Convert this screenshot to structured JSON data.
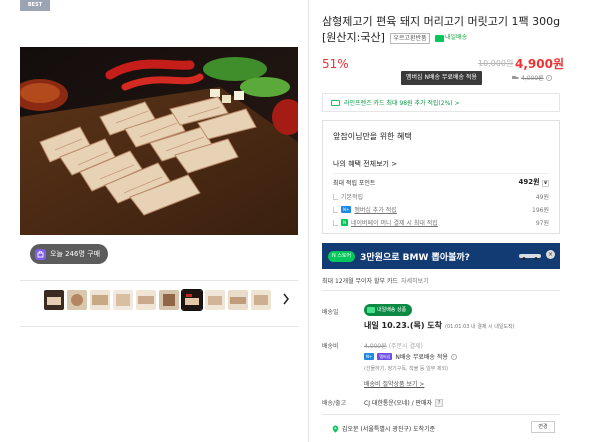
{
  "badge": "BEST",
  "product": {
    "title": "삼형제고기 편육 돼지 머리고기 머릿고기 1팩 300g [원산지:국산]",
    "tag_guarantee": "우르고환반품",
    "tag_delivery": "내일배송"
  },
  "price": {
    "discount": "51%",
    "original": "10,000원",
    "sale": "4,900원",
    "member_tip": "멤버십 N배송 무료배송 적용",
    "member_original": "4,000원"
  },
  "card_banner": "라인프렌즈 카드 최대 98원 추가 적립(2%) >",
  "benefits": {
    "title": "앞잡이님만을 위한 혜택",
    "view_all": "나의 혜택 전체보기 >",
    "max_label": "최대 적립 포인트",
    "max_value": "492원",
    "items": [
      {
        "label": "기본적립",
        "value": "49원"
      },
      {
        "label": "멤버십 추가 적립",
        "value": "196원",
        "badge": "N+"
      },
      {
        "label": "네이버페이 머니 결제 시 최대 적립",
        "value": "97원",
        "badge": "N"
      }
    ]
  },
  "ad": {
    "pill": "N 스토어",
    "text": "3만원으로 BMW 뽑아볼까?",
    "close": "×"
  },
  "installment": {
    "text": "최대 12개월 무이자 할부 카드",
    "more": "자세히보기"
  },
  "gallery": {
    "sold_text": "오늘 246명 구매",
    "thumb_count_selected": 8
  },
  "delivery": {
    "label": "배송일",
    "badge": "내일배송 상품",
    "date": "내일 10.23.(목) 도착",
    "note": "(01:01:03 내 결제 시 내일도착)"
  },
  "shipping_fee": {
    "label": "배송비",
    "amount": "4,000원",
    "condition": "(주문시 결제)",
    "free_text": "N배송 무료배송 적용",
    "free_badge_n": "N+",
    "free_badge_member": "멤버십",
    "sub": "(선물하기, 정기구독, 착불 등 일부 제외)",
    "link": "배송비 절약상품 보기"
  },
  "carrier": {
    "label": "배송/출고",
    "value": "CJ 대한통운(오네) / 판매자",
    "help": "?"
  },
  "location": {
    "text": "김오문 (서울특별시 광진구) 도착기준",
    "change": "변경"
  },
  "colors": {
    "red": "#ee3333",
    "green": "#03c75a",
    "ad_bg": "#123b74"
  }
}
